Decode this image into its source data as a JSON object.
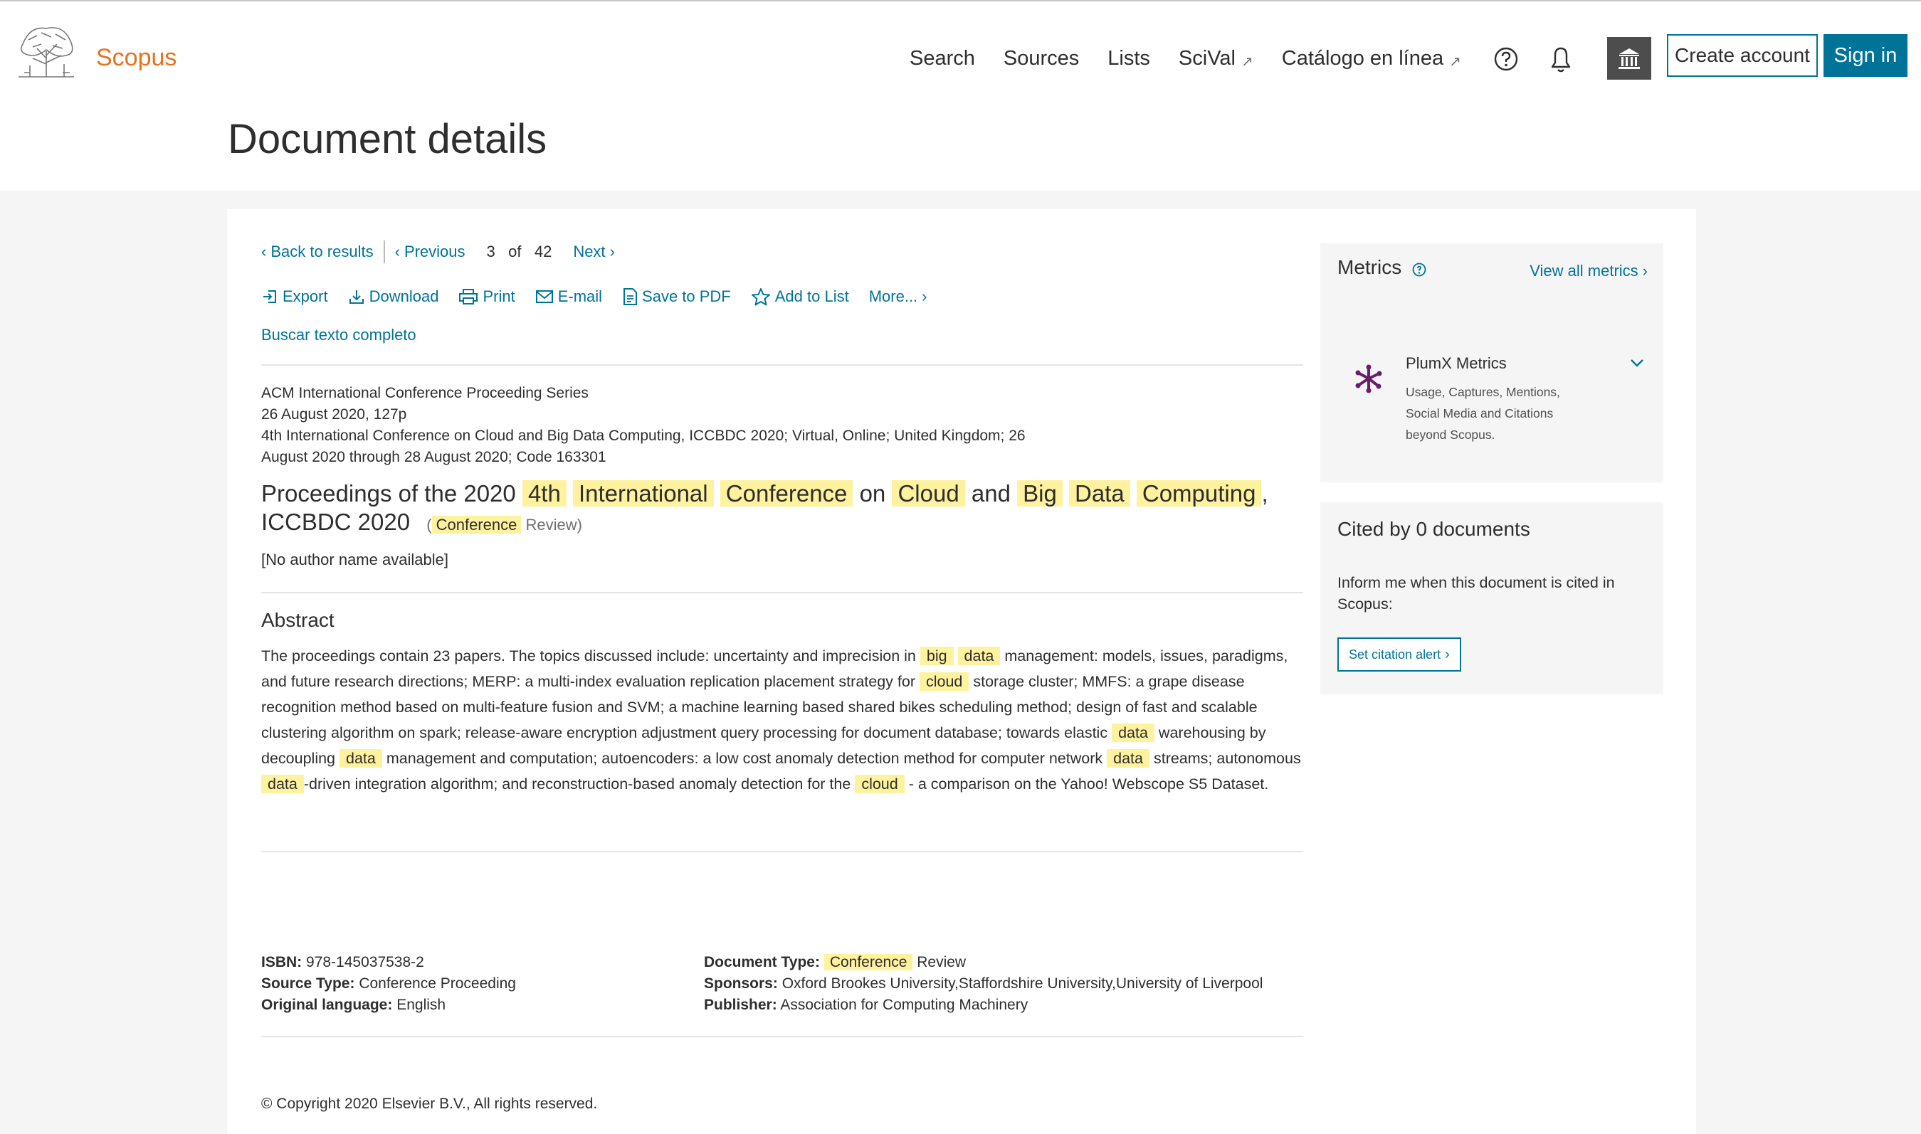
{
  "header": {
    "brand": "Scopus",
    "nav": [
      {
        "label": "Search",
        "external": false
      },
      {
        "label": "Sources",
        "external": false
      },
      {
        "label": "Lists",
        "external": false
      },
      {
        "label": "SciVal",
        "external": true
      },
      {
        "label": "Catálogo en línea",
        "external": true
      }
    ],
    "create_account": "Create account",
    "sign_in": "Sign in",
    "icons": [
      "help-icon",
      "bell-icon",
      "institution-icon"
    ]
  },
  "page_title": "Document details",
  "results_nav": {
    "back": "Back to results",
    "previous": "Previous",
    "current": "3",
    "of": "of",
    "total": "42",
    "next": "Next"
  },
  "toolbar": {
    "export": "Export",
    "download": "Download",
    "print": "Print",
    "email": "E-mail",
    "save_pdf": "Save to PDF",
    "add_list": "Add to List",
    "more": "More..."
  },
  "full_text": "Buscar texto completo",
  "meta": {
    "line1": "ACM International Conference Proceeding Series",
    "line2": "26 August 2020, 127p",
    "line3": "4th International Conference on Cloud and Big Data Computing, ICCBDC 2020; Virtual, Online; United Kingdom; 26",
    "line4": "August 2020 through 28 August 2020; Code 163301"
  },
  "title": {
    "t1": "Proceedings of the 2020",
    "h1": "4th",
    "h2": "International",
    "h3": "Conference",
    "t2": "on",
    "h4": "Cloud",
    "t3": "and",
    "h5": "Big",
    "h6": "Data",
    "h7": "Computing",
    "t4": ",",
    "t5": "ICCBDC 2020",
    "sub_open": "(",
    "sub_hl": "Conference",
    "sub_rest": "Review)"
  },
  "authors": "[No author name available]",
  "abstract": {
    "heading": "Abstract",
    "p1": "The proceedings contain 23 papers. The topics discussed include: uncertainty and imprecision in",
    "h1": "big",
    "h2": "data",
    "p2": "management: models, issues, paradigms, and future research directions; MERP: a multi-index evaluation replication placement strategy for",
    "h3": "cloud",
    "p3": "storage cluster; MMFS: a grape disease recognition method based on multi-feature fusion and SVM; a machine learning based shared bikes scheduling method; design of fast and scalable clustering algorithm on spark; release-aware encryption adjustment query processing for document database; towards elastic",
    "h4": "data",
    "p4": "warehousing by decoupling",
    "h5": "data",
    "p5": "management and computation; autoencoders: a low cost anomaly detection method for computer network",
    "h6": "data",
    "p6": "streams; autonomous",
    "h7": "data",
    "p7": "-driven integration algorithm; and reconstruction-based anomaly detection for the",
    "h8": "cloud",
    "p8": "- a comparison on the Yahoo! Webscope S5 Dataset."
  },
  "details": {
    "isbn_label": "ISBN:",
    "isbn": "978-145037538-2",
    "source_type_label": "Source Type:",
    "source_type": "Conference Proceeding",
    "language_label": "Original language:",
    "language": "English",
    "doc_type_label": "Document Type:",
    "doc_type_hl": "Conference",
    "doc_type_rest": "Review",
    "sponsors_label": "Sponsors:",
    "sponsors": "Oxford Brookes University,Staffordshire University,University of Liverpool",
    "publisher_label": "Publisher:",
    "publisher": "Association for Computing Machinery"
  },
  "copyright": "© Copyright 2020 Elsevier B.V., All rights reserved.",
  "metrics": {
    "title": "Metrics",
    "view_all": "View all metrics",
    "plumx_title": "PlumX Metrics",
    "plumx_desc1": "Usage, Captures, Mentions,",
    "plumx_desc2": "Social Media and Citations",
    "plumx_desc3": "beyond Scopus."
  },
  "cited": {
    "title": "Cited by 0 documents",
    "text": "Inform me when this document is cited in Scopus:",
    "button": "Set citation alert"
  },
  "colors": {
    "link": "#007398",
    "brand": "#e9711c",
    "highlight": "#fff29e",
    "panel": "#f5f5f5"
  }
}
